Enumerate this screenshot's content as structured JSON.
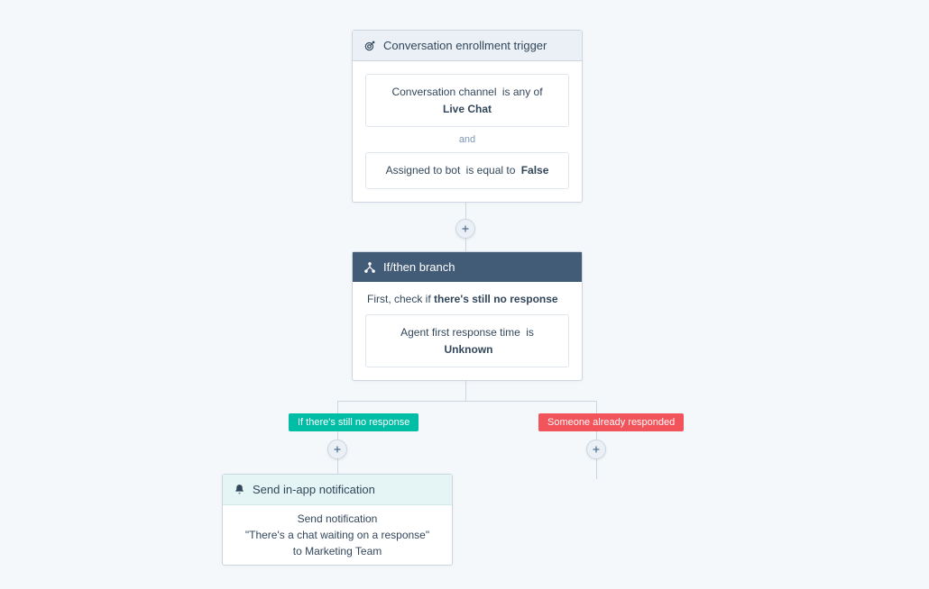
{
  "trigger": {
    "title": "Conversation enrollment trigger",
    "filter1_prop": "Conversation channel",
    "filter1_op": "is any of",
    "filter1_val": "Live Chat",
    "and": "and",
    "filter2_prop": "Assigned to bot",
    "filter2_op": "is equal to",
    "filter2_val": "False"
  },
  "branch": {
    "title": "If/then branch",
    "check_prefix": "First, check if ",
    "check_bold": "there's still no response",
    "filter_prop": "Agent first response time",
    "filter_op": "is",
    "filter_val": "Unknown"
  },
  "labels": {
    "left": "If there's still no response",
    "right": "Someone already responded"
  },
  "action": {
    "title": "Send in-app notification",
    "line1": "Send notification",
    "line2": "\"There's a chat waiting on a response\"",
    "line3_prefix": "to ",
    "line3_val": "Marketing Team"
  }
}
